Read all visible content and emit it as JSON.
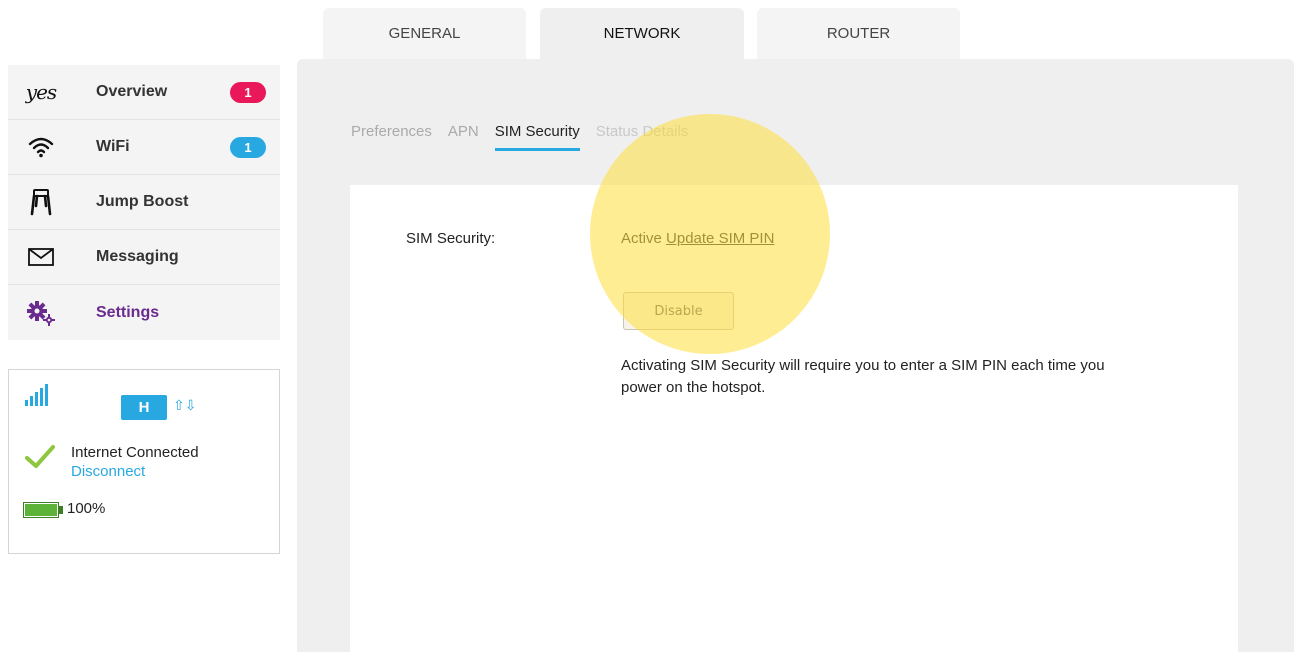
{
  "top_tabs": [
    {
      "label": "GENERAL"
    },
    {
      "label": "NETWORK",
      "active": true
    },
    {
      "label": "ROUTER"
    }
  ],
  "sidebar": {
    "logo_text": "yes",
    "items": [
      {
        "label": "Overview",
        "icon": "yes-logo",
        "badge": "1",
        "badge_color": "#e8185a"
      },
      {
        "label": "WiFi",
        "icon": "wifi-icon",
        "badge": "1",
        "badge_color": "#28a8e0"
      },
      {
        "label": "Jump Boost",
        "icon": "jump-boost-icon"
      },
      {
        "label": "Messaging",
        "icon": "envelope-icon"
      },
      {
        "label": "Settings",
        "icon": "gears-icon",
        "active": true
      }
    ]
  },
  "status": {
    "network_type": "H",
    "arrows": "⇧⇩",
    "connection": "Internet Connected",
    "disconnect": "Disconnect",
    "battery": "100%",
    "battery_level": 1.0
  },
  "subtabs": [
    {
      "label": "Preferences"
    },
    {
      "label": "APN"
    },
    {
      "label": "SIM Security",
      "active": true
    },
    {
      "label": "Status Details"
    }
  ],
  "sim": {
    "label": "SIM Security:",
    "status": "Active",
    "update_link": "Update SIM PIN",
    "disable_button": "Disable",
    "description": "Activating SIM Security will require you to enter a SIM PIN each time you power on the hotspot."
  },
  "colors": {
    "accent": "#28a8e0",
    "active_nav": "#6a2a8e",
    "badge_red": "#e8185a",
    "check_green": "#8dc63f",
    "battery_green": "#5cb338",
    "highlight": "#ffde3c"
  }
}
